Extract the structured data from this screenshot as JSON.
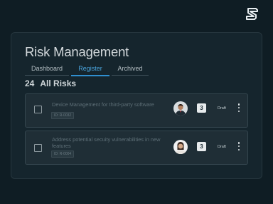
{
  "header": {
    "title": "Risk Management"
  },
  "tabs": [
    {
      "label": "Dashboard",
      "active": false
    },
    {
      "label": "Register",
      "active": true
    },
    {
      "label": "Archived",
      "active": false
    }
  ],
  "summary": {
    "count": "24",
    "label": "All Risks"
  },
  "risks": [
    {
      "title": "Device Management for third-party software",
      "id": "ID: R-0032",
      "score": "3",
      "status": "Draft",
      "avatar_icon": "user-avatar-male"
    },
    {
      "title": "Address potential secuity vulnerabilities in new features",
      "id": "ID: R-0004",
      "score": "3",
      "status": "Draft",
      "avatar_icon": "user-avatar-female"
    }
  ],
  "colors": {
    "accent": "#2f8fd0",
    "background": "#0f1d24"
  }
}
